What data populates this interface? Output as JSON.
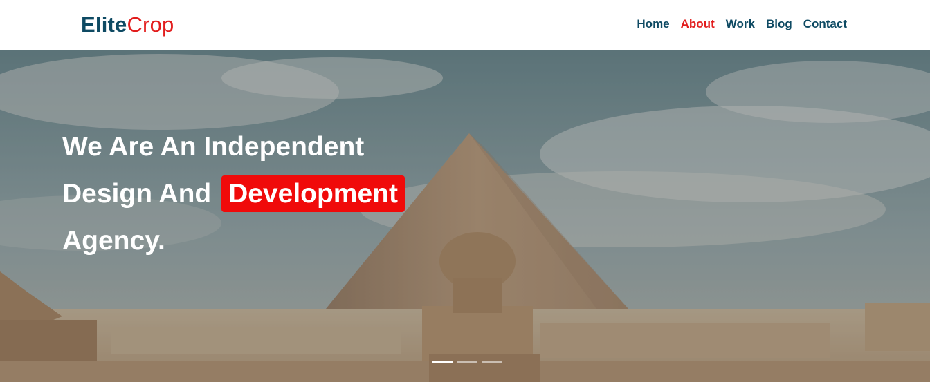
{
  "brand": {
    "part1": "Elite",
    "part2": "Crop"
  },
  "nav": {
    "items": [
      {
        "label": "Home",
        "active": false
      },
      {
        "label": "About",
        "active": true
      },
      {
        "label": "Work",
        "active": false
      },
      {
        "label": "Blog",
        "active": false
      },
      {
        "label": "Contact",
        "active": false
      }
    ]
  },
  "hero": {
    "line1": "We Are An Independent",
    "line2_prefix": "Design And",
    "line2_highlight": "Development",
    "line3": "Agency.",
    "slider": {
      "slide_count": 3,
      "active_index": 0
    }
  },
  "colors": {
    "brand_dark": "#0e4a63",
    "accent_red": "#e21d1d",
    "highlight_bg": "#f00a0a"
  }
}
